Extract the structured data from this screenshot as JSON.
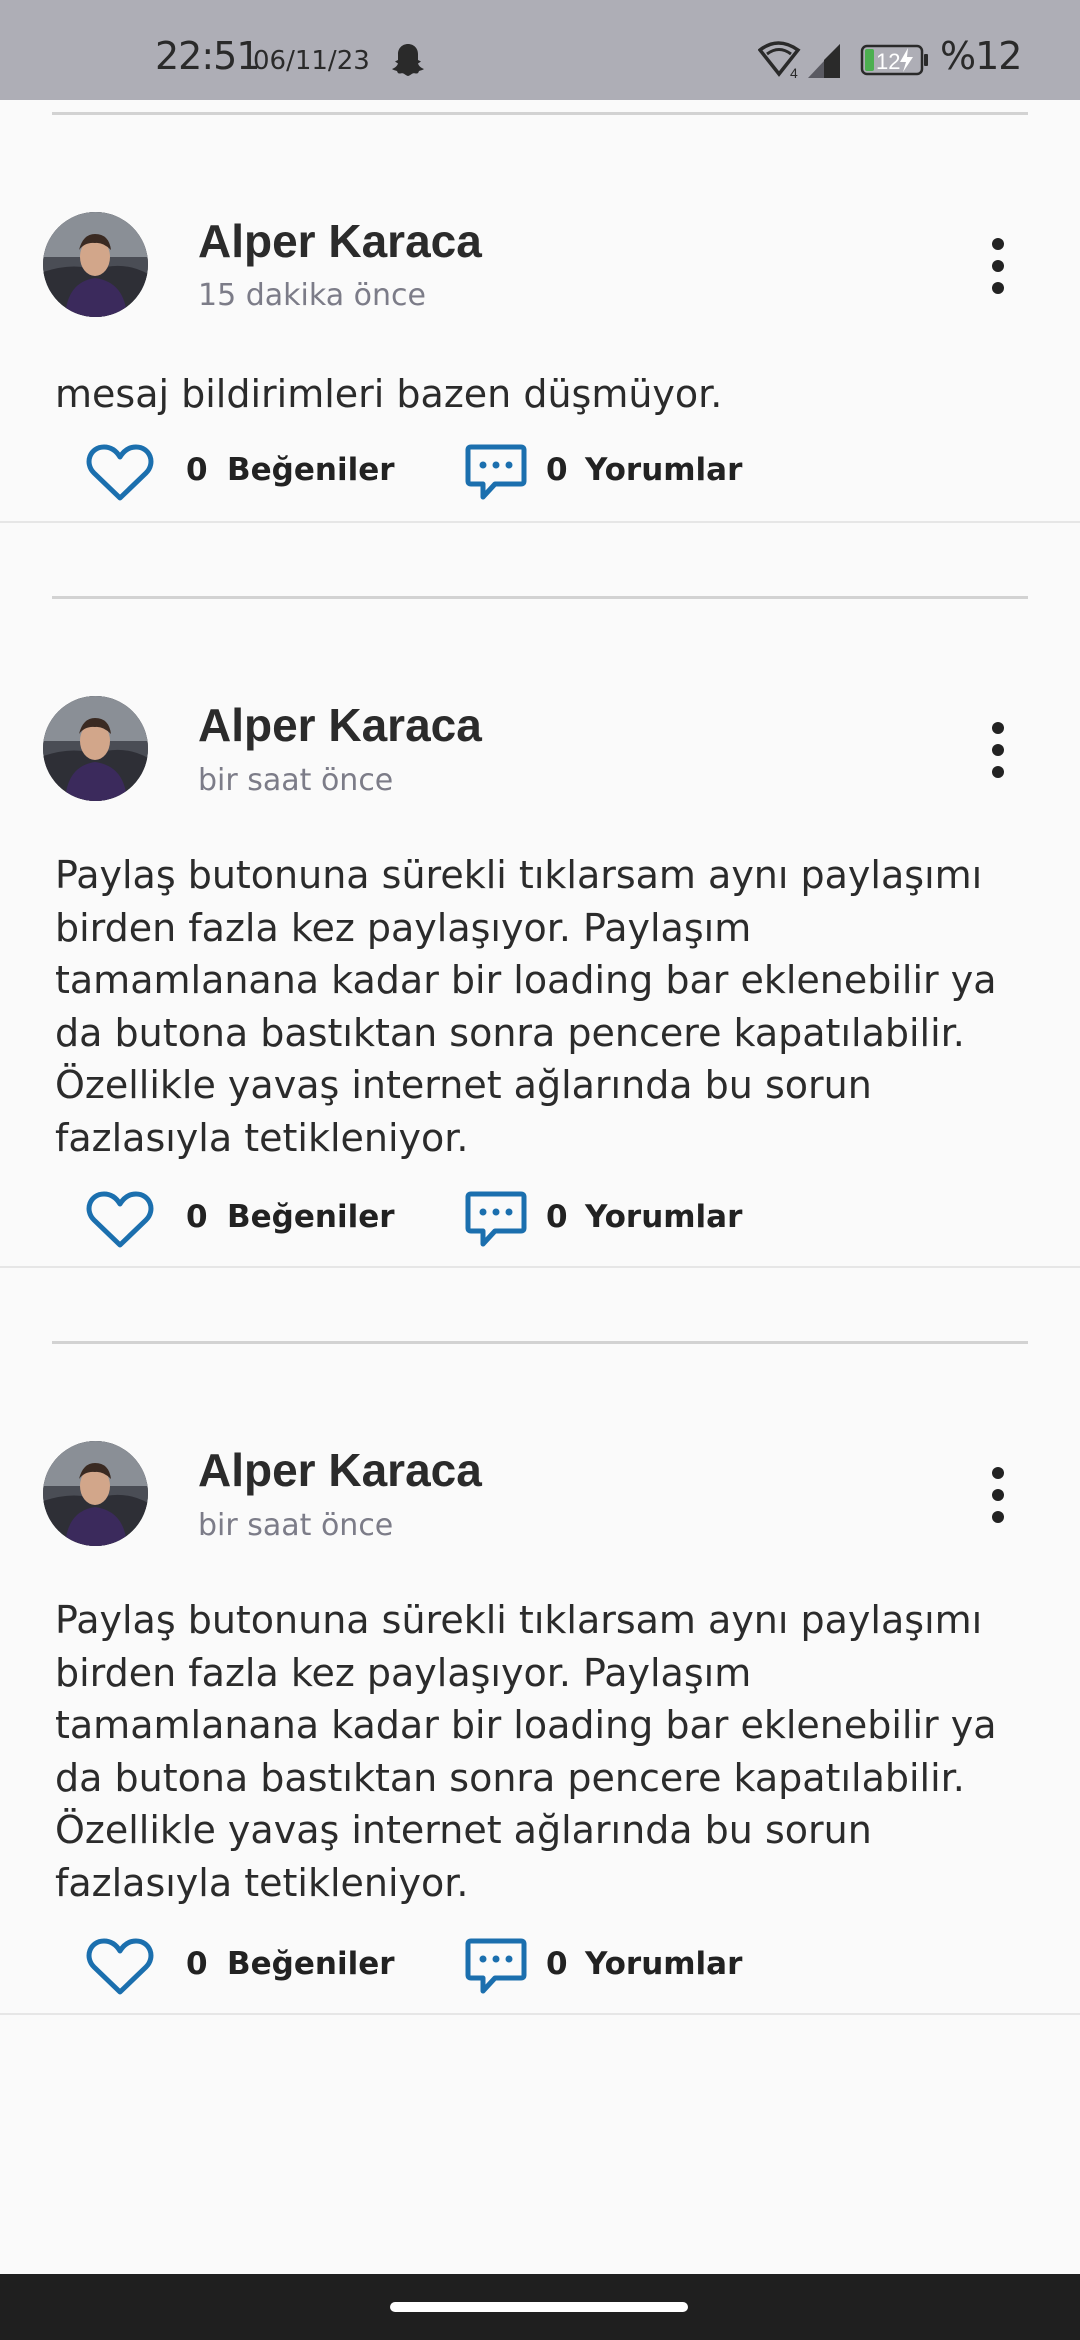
{
  "status_bar": {
    "time": "22:51",
    "date": "06/11/23",
    "battery_level": "12",
    "battery_percent": "%12",
    "icons": [
      "snapchat-icon",
      "wifi-icon",
      "signal-icon",
      "battery-charging-icon"
    ]
  },
  "colors": {
    "accent": "#1b6fae",
    "status_bar_bg": "#aeaeb6",
    "background": "#fafafa",
    "nav_bar": "#1f1f1f",
    "battery_green": "#4caf50"
  },
  "posts": [
    {
      "author": "Alper Karaca",
      "time_ago": "15 dakika önce",
      "body": "mesaj bildirimleri bazen düşmüyor.",
      "likes": "0",
      "likes_label": "Beğeniler",
      "comments": "0",
      "comments_label": "Yorumlar"
    },
    {
      "author": "Alper Karaca",
      "time_ago": "bir saat önce",
      "body": "Paylaş butonuna sürekli tıklarsam aynı paylaşımı\nbirden fazla kez paylaşıyor. Paylaşım\ntamamlanana kadar bir loading bar eklenebilir ya\nda butona bastıktan sonra pencere kapatılabilir.\nÖzellikle yavaş internet ağlarında bu sorun\nfazlasıyla tetikleniyor.",
      "likes": "0",
      "likes_label": "Beğeniler",
      "comments": "0",
      "comments_label": "Yorumlar"
    },
    {
      "author": "Alper Karaca",
      "time_ago": "bir saat önce",
      "body": "Paylaş butonuna sürekli tıklarsam aynı paylaşımı\nbirden fazla kez paylaşıyor. Paylaşım\ntamamlanana kadar bir loading bar eklenebilir ya\nda butona bastıktan sonra pencere kapatılabilir.\nÖzellikle yavaş internet ağlarında bu sorun\nfazlasıyla tetikleniyor.",
      "likes": "0",
      "likes_label": "Beğeniler",
      "comments": "0",
      "comments_label": "Yorumlar"
    }
  ]
}
